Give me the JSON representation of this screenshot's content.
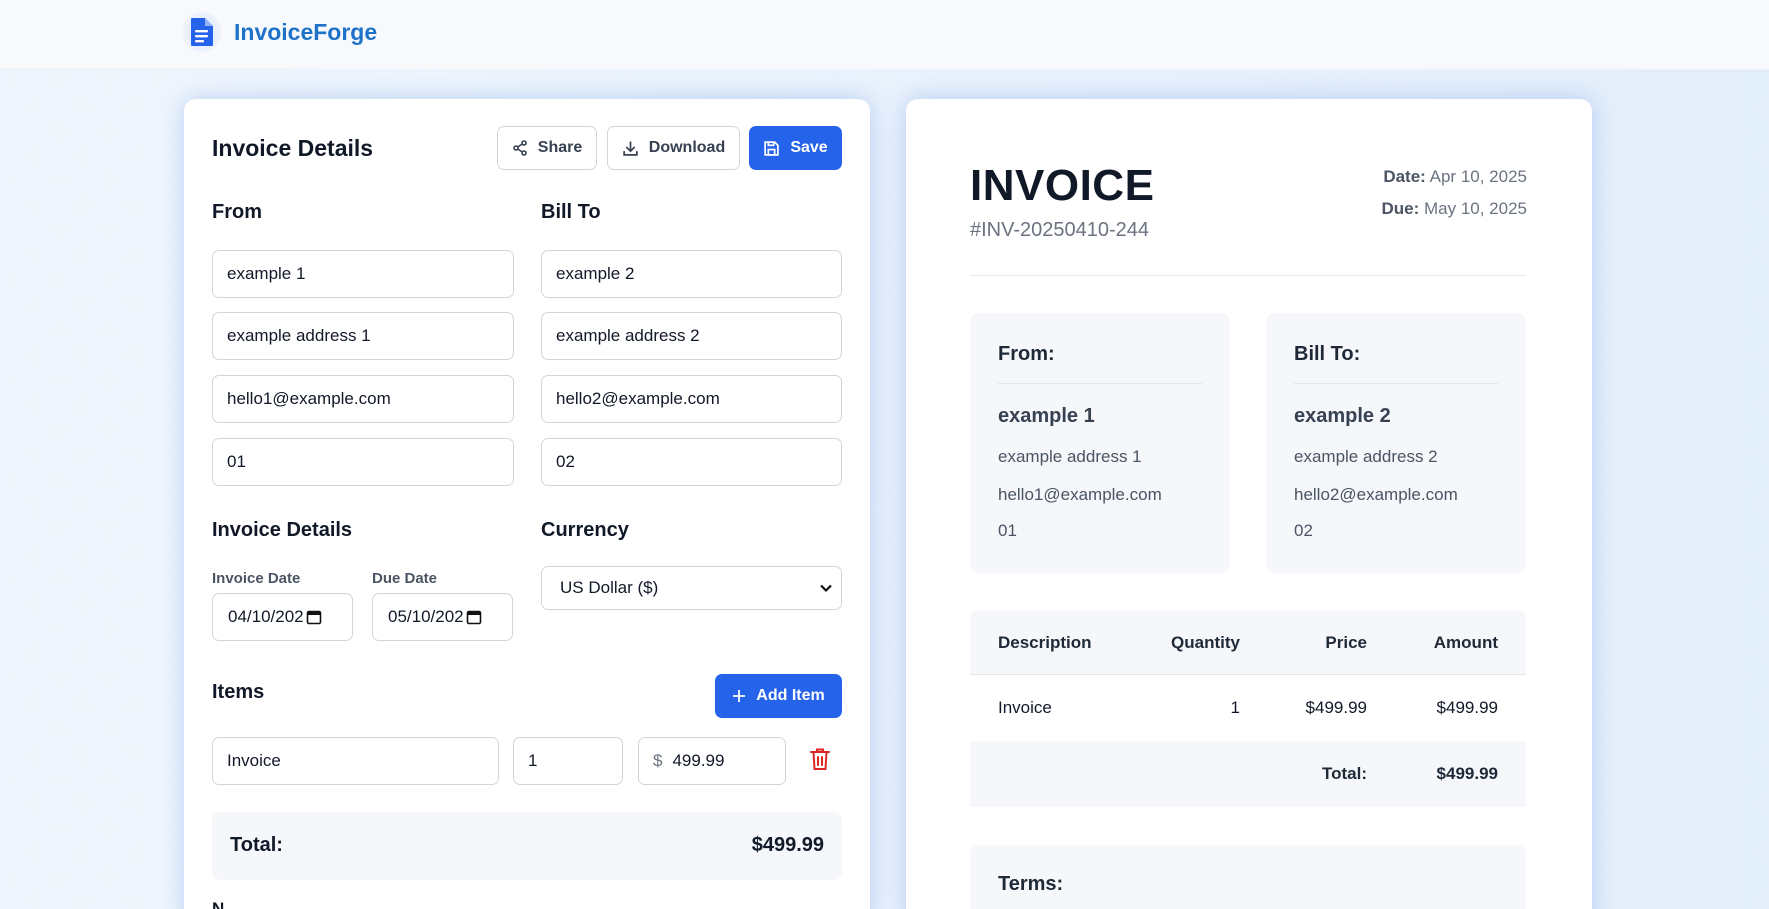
{
  "app": {
    "name": "InvoiceForge"
  },
  "editor": {
    "title": "Invoice Details",
    "buttons": {
      "share": "Share",
      "download": "Download",
      "save": "Save",
      "add_item": "Add Item"
    },
    "from_heading": "From",
    "bill_to_heading": "Bill To",
    "from": {
      "name": "example 1",
      "address": "example address 1",
      "email": "hello1@example.com",
      "phone": "01"
    },
    "bill_to": {
      "name": "example 2",
      "address": "example address 2",
      "email": "hello2@example.com",
      "phone": "02"
    },
    "details_heading": "Invoice Details",
    "currency_heading": "Currency",
    "invoice_date_label": "Invoice Date",
    "due_date_label": "Due Date",
    "invoice_date_value": "04/10/202",
    "due_date_value": "05/10/202",
    "currency_value": "US Dollar ($)",
    "items_heading": "Items",
    "item": {
      "description": "Invoice",
      "quantity": "1",
      "currency_symbol": "$",
      "price": "499.99"
    },
    "total_label": "Total:",
    "total_value": "$499.99",
    "notes_label": "N"
  },
  "preview": {
    "title": "INVOICE",
    "number": "#INV-20250410-244",
    "date_label": "Date:",
    "date_value": "Apr 10, 2025",
    "due_label": "Due:",
    "due_value": "May 10, 2025",
    "from_heading": "From:",
    "bill_to_heading": "Bill To:",
    "from": {
      "name": "example 1",
      "address": "example address 1",
      "email": "hello1@example.com",
      "phone": "01"
    },
    "bill_to": {
      "name": "example 2",
      "address": "example address 2",
      "email": "hello2@example.com",
      "phone": "02"
    },
    "table": {
      "headers": {
        "description": "Description",
        "quantity": "Quantity",
        "price": "Price",
        "amount": "Amount"
      },
      "rows": [
        {
          "description": "Invoice",
          "quantity": "1",
          "price": "$499.99",
          "amount": "$499.99"
        }
      ],
      "total_label": "Total:",
      "total_value": "$499.99"
    },
    "terms_heading": "Terms:"
  },
  "colors": {
    "primary": "#2563eb",
    "brand": "#1e73c9",
    "danger": "#dc2626"
  }
}
